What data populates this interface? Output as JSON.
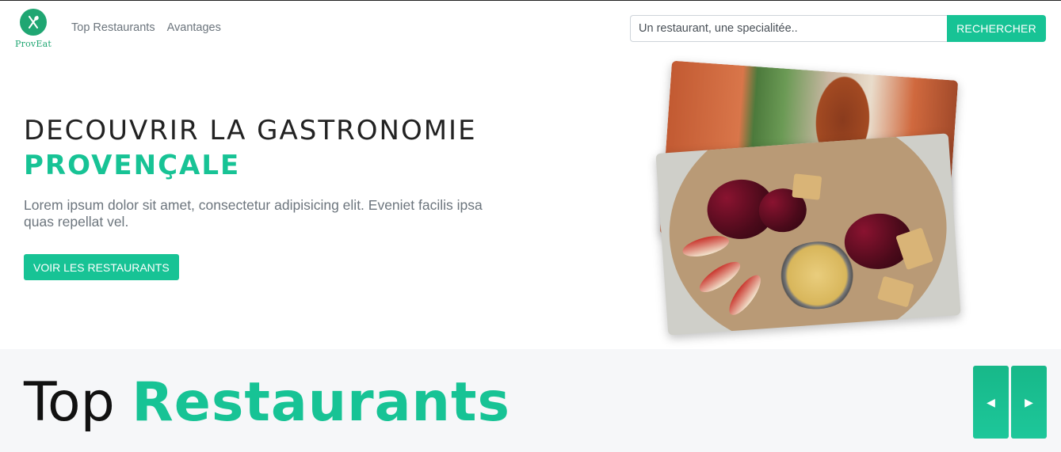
{
  "brand": {
    "name": "ProvEat",
    "icon": "fork-knife-icon",
    "color": "#1fa672"
  },
  "nav": {
    "links": [
      "Top Restaurants",
      "Avantages"
    ]
  },
  "search": {
    "placeholder": "Un restaurant, une specialitée..",
    "button_label": "RECHERCHER"
  },
  "hero": {
    "title_line1": "DECOUVRIR LA GASTRONOMIE",
    "title_line2": "PROVENÇALE",
    "text": "Lorem ipsum dolor sit amet, consectetur adipisicing elit. Eveniet facilis ipsa quas repellat vel.",
    "cta_label": "VOIR LES RESTAURANTS",
    "images": [
      "street-photo",
      "food-platter-photo"
    ]
  },
  "top_restaurants": {
    "title_part1": "Top",
    "title_part2": "Restaurants",
    "prev_icon": "triangle-left-icon",
    "next_icon": "triangle-right-icon"
  },
  "colors": {
    "accent": "#17c395",
    "text": "#222222",
    "muted": "#6c757d",
    "section_bg": "#f6f7f9"
  }
}
